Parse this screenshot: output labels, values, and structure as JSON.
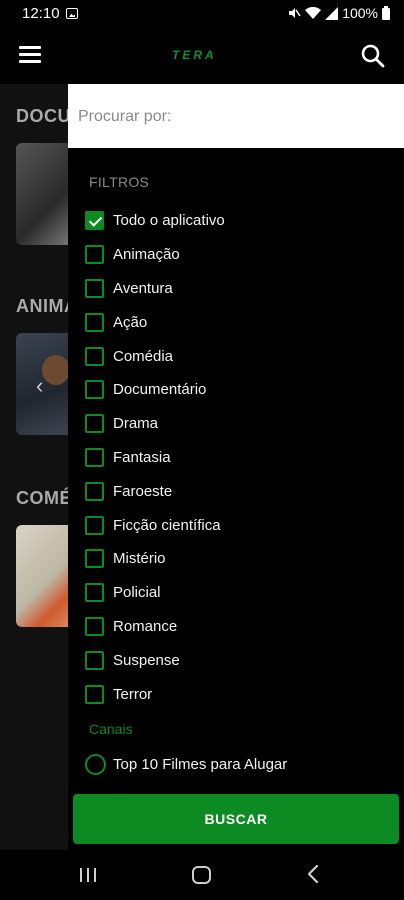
{
  "status_bar": {
    "time": "12:10",
    "battery": "100%"
  },
  "header": {
    "logo_text": "TERA",
    "icons": [
      "menu-icon",
      "search-icon"
    ]
  },
  "background": {
    "sections": [
      {
        "title": "DOCU"
      },
      {
        "title": "ANIMA"
      },
      {
        "title": "COMÉ"
      }
    ]
  },
  "drawer": {
    "search": {
      "placeholder": "Procurar por:",
      "value": ""
    },
    "filters_heading": "FILTROS",
    "filters": [
      {
        "label": "Todo o aplicativo",
        "checked": true
      },
      {
        "label": "Animação",
        "checked": false
      },
      {
        "label": "Aventura",
        "checked": false
      },
      {
        "label": "Ação",
        "checked": false
      },
      {
        "label": "Comédia",
        "checked": false
      },
      {
        "label": "Documentário",
        "checked": false
      },
      {
        "label": "Drama",
        "checked": false
      },
      {
        "label": "Fantasia",
        "checked": false
      },
      {
        "label": "Faroeste",
        "checked": false
      },
      {
        "label": "Ficção científica",
        "checked": false
      },
      {
        "label": "Mistério",
        "checked": false
      },
      {
        "label": "Policial",
        "checked": false
      },
      {
        "label": "Romance",
        "checked": false
      },
      {
        "label": "Suspense",
        "checked": false
      },
      {
        "label": "Terror",
        "checked": false
      }
    ],
    "channels_heading": "Canais",
    "channels": [
      {
        "label": "Top 10 Filmes para Alugar",
        "selected": false
      }
    ],
    "search_button_label": "BUSCAR"
  },
  "colors": {
    "accent": "#0e8a22",
    "background": "#000000",
    "heading_gray": "#8a8a8a"
  }
}
